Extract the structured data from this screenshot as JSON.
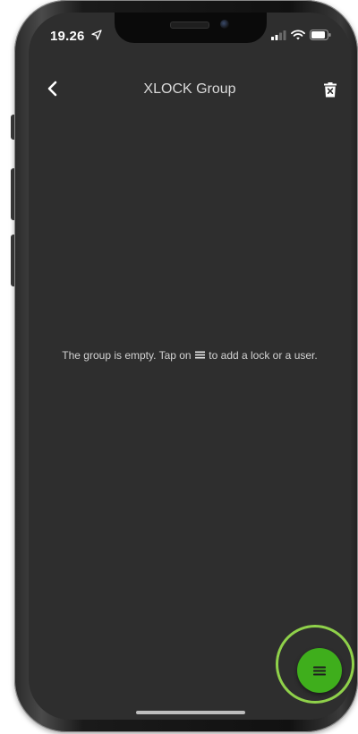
{
  "status_bar": {
    "time": "19.26",
    "icons": [
      "location-arrow-icon",
      "signal-icon",
      "wifi-icon",
      "battery-icon"
    ]
  },
  "header": {
    "title": "XLOCK Group",
    "back_icon": "chevron-left-icon",
    "delete_icon": "trash-icon"
  },
  "content": {
    "empty_prefix": "The group is empty. Tap on",
    "empty_suffix": "to add a lock or a user.",
    "inline_icon": "menu-icon"
  },
  "fab": {
    "icon": "menu-icon",
    "color": "#3fae1c",
    "highlight_color": "#8fd14a"
  },
  "colors": {
    "background": "#2e2e2e",
    "text": "#d2d2d2",
    "accent": "#3fae1c"
  }
}
